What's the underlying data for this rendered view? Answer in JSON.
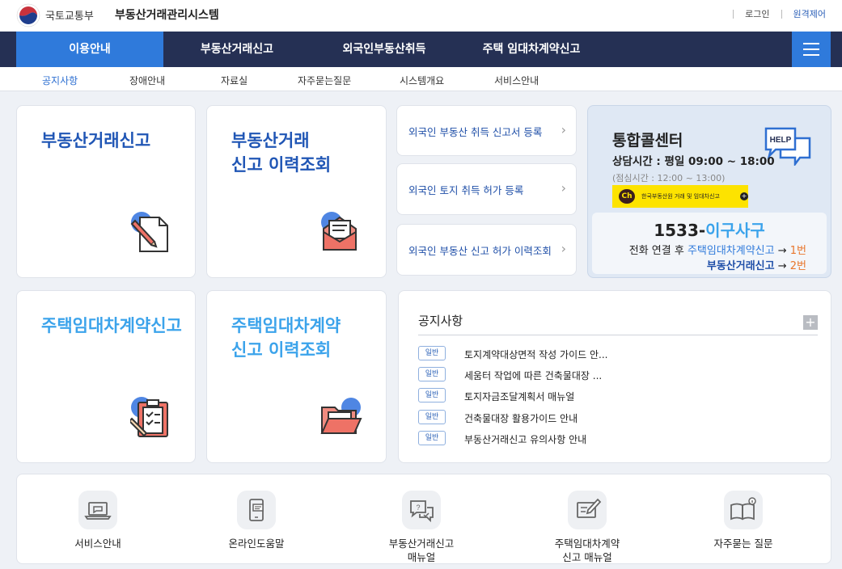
{
  "header": {
    "ministry": "국토교통부",
    "system_name": "부동산거래관리시스템",
    "login": "로그인",
    "remote": "원격제어"
  },
  "nav": {
    "tabs": [
      "이용안내",
      "부동산거래신고",
      "외국인부동산취득",
      "주택 임대차계약신고"
    ]
  },
  "subnav": {
    "items": [
      "공지사항",
      "장애안내",
      "자료실",
      "자주묻는질문",
      "시스템개요",
      "서비스안내"
    ]
  },
  "cards": {
    "real_estate_report": "부동산거래신고",
    "real_estate_history_1": "부동산거래",
    "real_estate_history_2": "신고 이력조회",
    "lease_report": "주택임대차계약신고",
    "lease_history_1": "주택임대차계약",
    "lease_history_2": "신고 이력조회"
  },
  "foreign_links": [
    "외국인 부동산 취득 신고서 등록",
    "외국인 토지 취득 허가 등록",
    "외국인 부동산 신고 허가 이력조회"
  ],
  "callcenter": {
    "title": "통합콜센터",
    "hours": "상담시간 : 평일 09:00 ~ 18:00",
    "lunch": "(점심시간 : 12:00 ~ 13:00)",
    "kakao_text": "한국부동산원 거래 및 임대차신고",
    "kakao_ch": "Ch",
    "help": "HELP",
    "phone_num": "1533-",
    "phone_word": "이구사구",
    "line1_pre": "전화 연결 후 ",
    "line1_service": "주택임대차계약신고",
    "line1_arrow": " → ",
    "line1_num": "1번",
    "line2_service": "부동산거래신고",
    "line2_arrow": " → ",
    "line2_num": "2번"
  },
  "notice": {
    "title": "공지사항",
    "badge": "일반",
    "items": [
      "토지계약대상면적 작성 가이드 안...",
      "세움터 작업에 따른 건축물대장 ...",
      "토지자금조달계획서 매뉴얼",
      "건축물대장 활용가이드 안내",
      "부동산거래신고 유의사항 안내"
    ]
  },
  "bottom": {
    "service": "서비스안내",
    "online_help": "온라인도움말",
    "re_manual_1": "부동산거래신고",
    "re_manual_2": "매뉴얼",
    "lease_manual_1": "주택임대차계약",
    "lease_manual_2": "신고 매뉴얼",
    "faq": "자주묻는 질문"
  },
  "colors": {
    "nav_bg": "#253054",
    "accent": "#2f7adb",
    "title_dark": "#2056b5",
    "title_light": "#3ba3eb",
    "highlight_orange": "#e8762c",
    "kakao_yellow": "#fde300"
  }
}
